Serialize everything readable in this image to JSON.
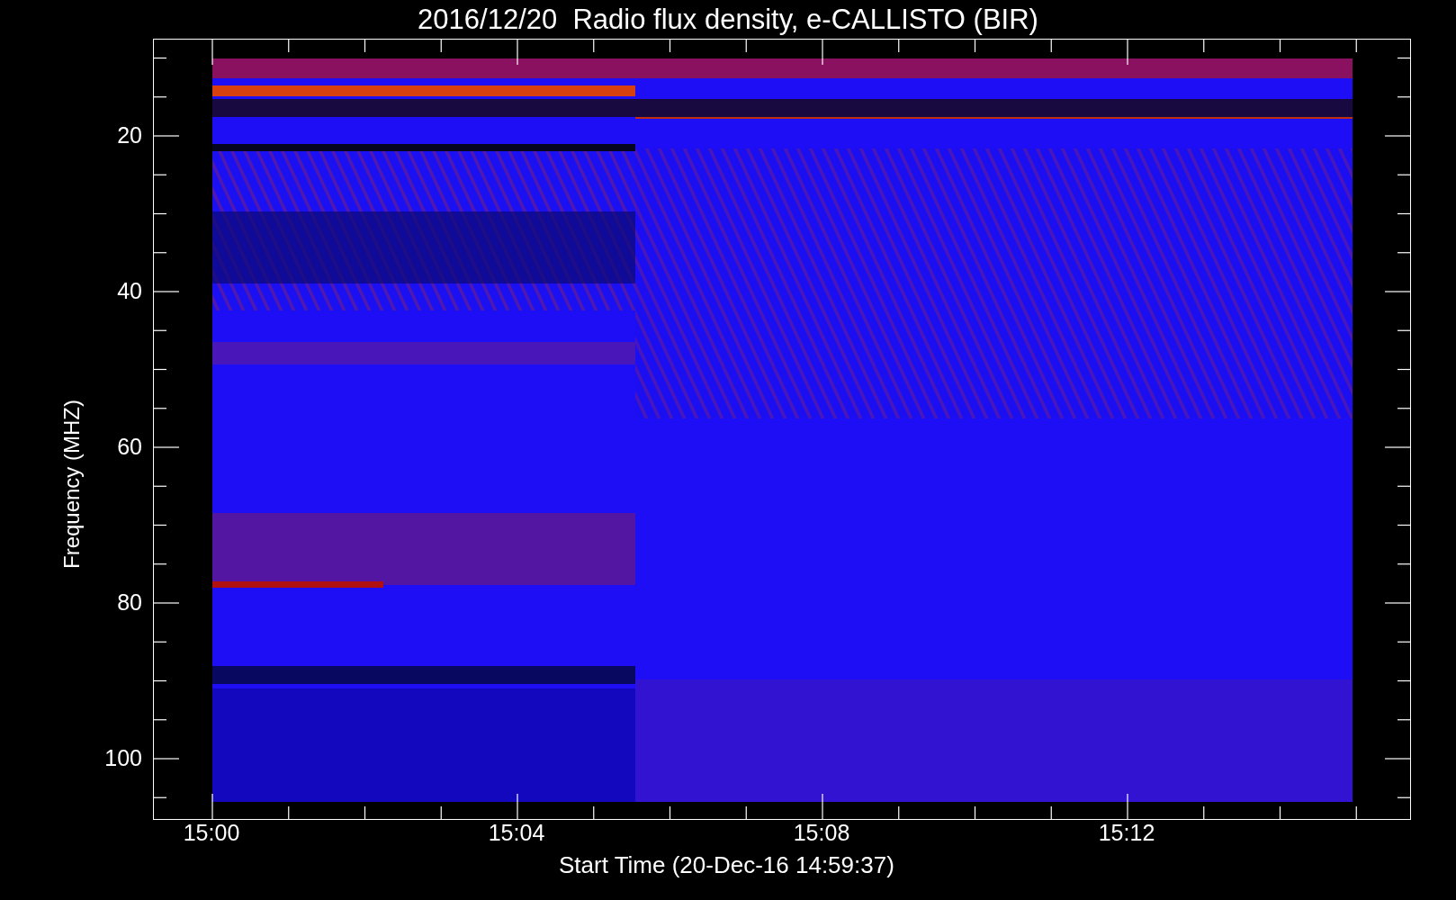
{
  "title": "2016/12/20  Radio flux density, e-CALLISTO (BIR)",
  "y_axis": {
    "label": "Frequency (MHZ)",
    "ticks": [
      "20",
      "40",
      "60",
      "80",
      "100"
    ]
  },
  "x_axis": {
    "label": "Start Time (20-Dec-16 14:59:37)",
    "ticks": [
      "15:00",
      "15:04",
      "15:08",
      "15:12"
    ]
  }
}
